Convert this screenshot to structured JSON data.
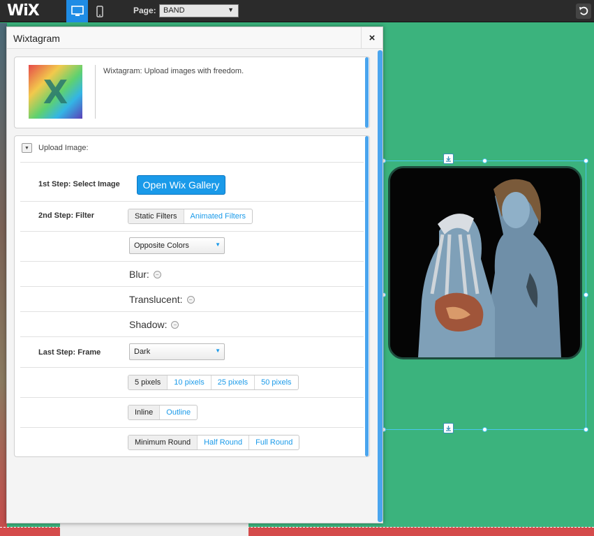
{
  "topbar": {
    "logo": "WiX",
    "page_label": "Page:",
    "page_value": "BAND"
  },
  "panel": {
    "title": "Wixtagram",
    "close": "×",
    "app_logo_letter": "X",
    "description": "Wixtagram: Upload images with freedom.",
    "section_title": "Upload Image:",
    "step1": {
      "label": "1st Step: Select Image",
      "button": "Open Wix Gallery"
    },
    "step2": {
      "label": "2nd Step: Filter",
      "tabs": [
        "Static Filters",
        "Animated Filters"
      ],
      "filter_value": "Opposite Colors",
      "options": [
        "Blur:",
        "Translucent:",
        "Shadow:"
      ]
    },
    "step3": {
      "label": "Last Step: Frame",
      "frame_value": "Dark",
      "sizes": [
        "5 pixels",
        "10 pixels",
        "25 pixels",
        "50 pixels"
      ],
      "styles": [
        "Inline",
        "Outline"
      ],
      "rounds": [
        "Minimum Round",
        "Half Round",
        "Full Round"
      ]
    }
  },
  "colors": {
    "canvas_green": "#3bb37d",
    "accent_blue": "#1a9ae9",
    "topbar": "#2b2b2b"
  }
}
